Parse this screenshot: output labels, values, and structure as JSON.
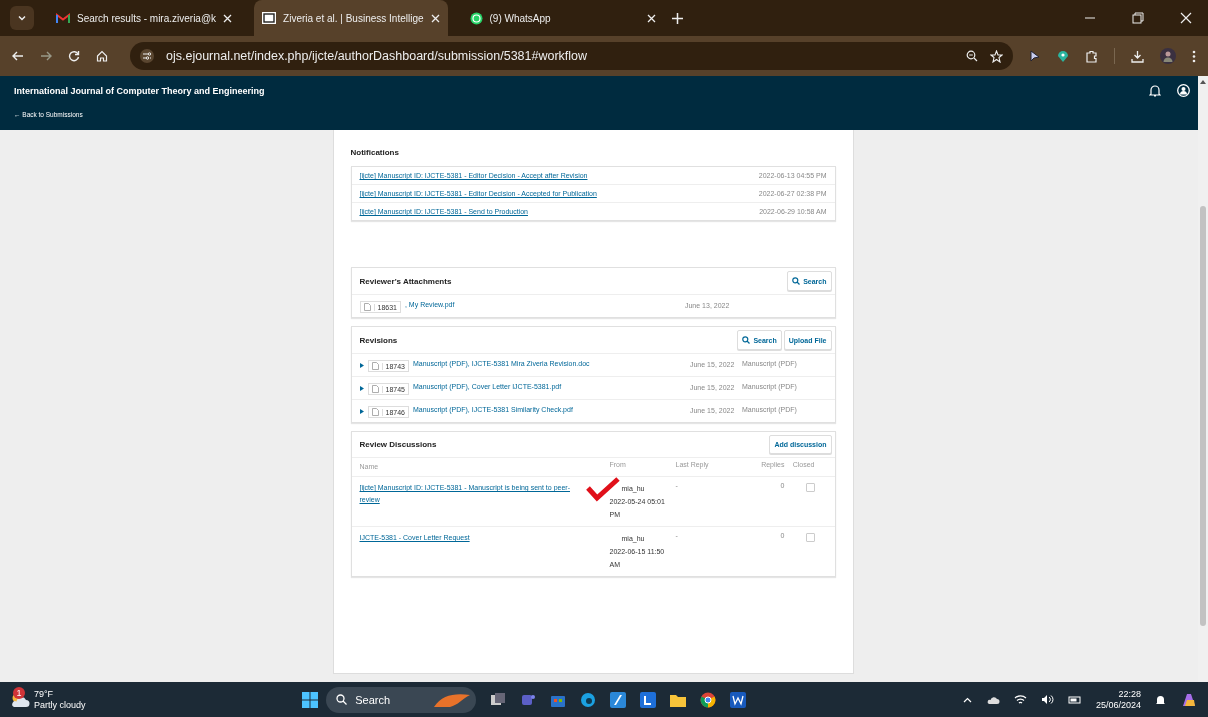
{
  "browser": {
    "tabs": [
      {
        "title": "Search results - mira.ziveria@k",
        "selected": false,
        "kind": "mail"
      },
      {
        "title": "Ziveria et al. | Business Intellige",
        "selected": true,
        "kind": "journal"
      },
      {
        "title": "(9) WhatsApp",
        "selected": false,
        "kind": "chat"
      }
    ],
    "url": "ojs.ejournal.net/index.php/ijcte/authorDashboard/submission/5381#workflow"
  },
  "header": {
    "journal_title": "International Journal of Computer Theory and Engineering",
    "back_link": "← Back to Submissions"
  },
  "notifications": {
    "title": "Notifications",
    "items": [
      {
        "text": "[ijcte] Manuscript ID: IJCTE-5381 - Editor Decision - Accept after Revision",
        "date": "2022-06-13 04:55 PM"
      },
      {
        "text": "[ijcte] Manuscript ID: IJCTE-5381 - Editor Decision - Accepted for Publication",
        "date": "2022-06-27 02:38 PM"
      },
      {
        "text": "[ijcte] Manuscript ID: IJCTE-5381 - Send to Production",
        "date": "2022-06-29 10:58 AM"
      }
    ]
  },
  "reviewer_attachments": {
    "title": "Reviewer's Attachments",
    "search_button": "Search",
    "files": [
      {
        "id": "18631",
        "name": ", My Review.pdf",
        "date": "June 13, 2022"
      }
    ]
  },
  "revisions": {
    "title": "Revisions",
    "search_button": "Search",
    "upload_button": "Upload File",
    "files": [
      {
        "id": "18743",
        "name": "Manuscript (PDF), IJCTE-5381 Mira Ziveria Revision.doc",
        "date": "June 15, 2022",
        "type": "Manuscript (PDF)"
      },
      {
        "id": "18745",
        "name": "Manuscript (PDF), Cover Letter IJCTE-5381.pdf",
        "date": "June 15, 2022",
        "type": "Manuscript (PDF)"
      },
      {
        "id": "18746",
        "name": "Manuscript (PDF), IJCTE-5381 Similarity Check.pdf",
        "date": "June 15, 2022",
        "type": "Manuscript (PDF)"
      }
    ]
  },
  "discussions": {
    "title": "Review Discussions",
    "add_button": "Add discussion",
    "columns": [
      "Name",
      "From",
      "Last Reply",
      "Replies",
      "Closed"
    ],
    "rows": [
      {
        "name": "[ijcte] Manuscript ID: IJCTE-5381 - Manuscript is being sent to peer-review",
        "from": "mia_hu",
        "date": "2022-05-24 05:01 PM",
        "last_reply": "-",
        "replies": "0",
        "closed": false,
        "marked": true
      },
      {
        "name": "IJCTE-5381 - Cover Letter Request",
        "from": "mia_hu",
        "date": "2022-06-15 11:50 AM",
        "last_reply": "-",
        "replies": "0",
        "closed": false,
        "marked": false
      }
    ]
  },
  "taskbar": {
    "weather_badge": "1",
    "temperature": "79°F",
    "condition": "Partly cloudy",
    "search": "Search",
    "time": "22:28",
    "date": "25/06/2024"
  }
}
